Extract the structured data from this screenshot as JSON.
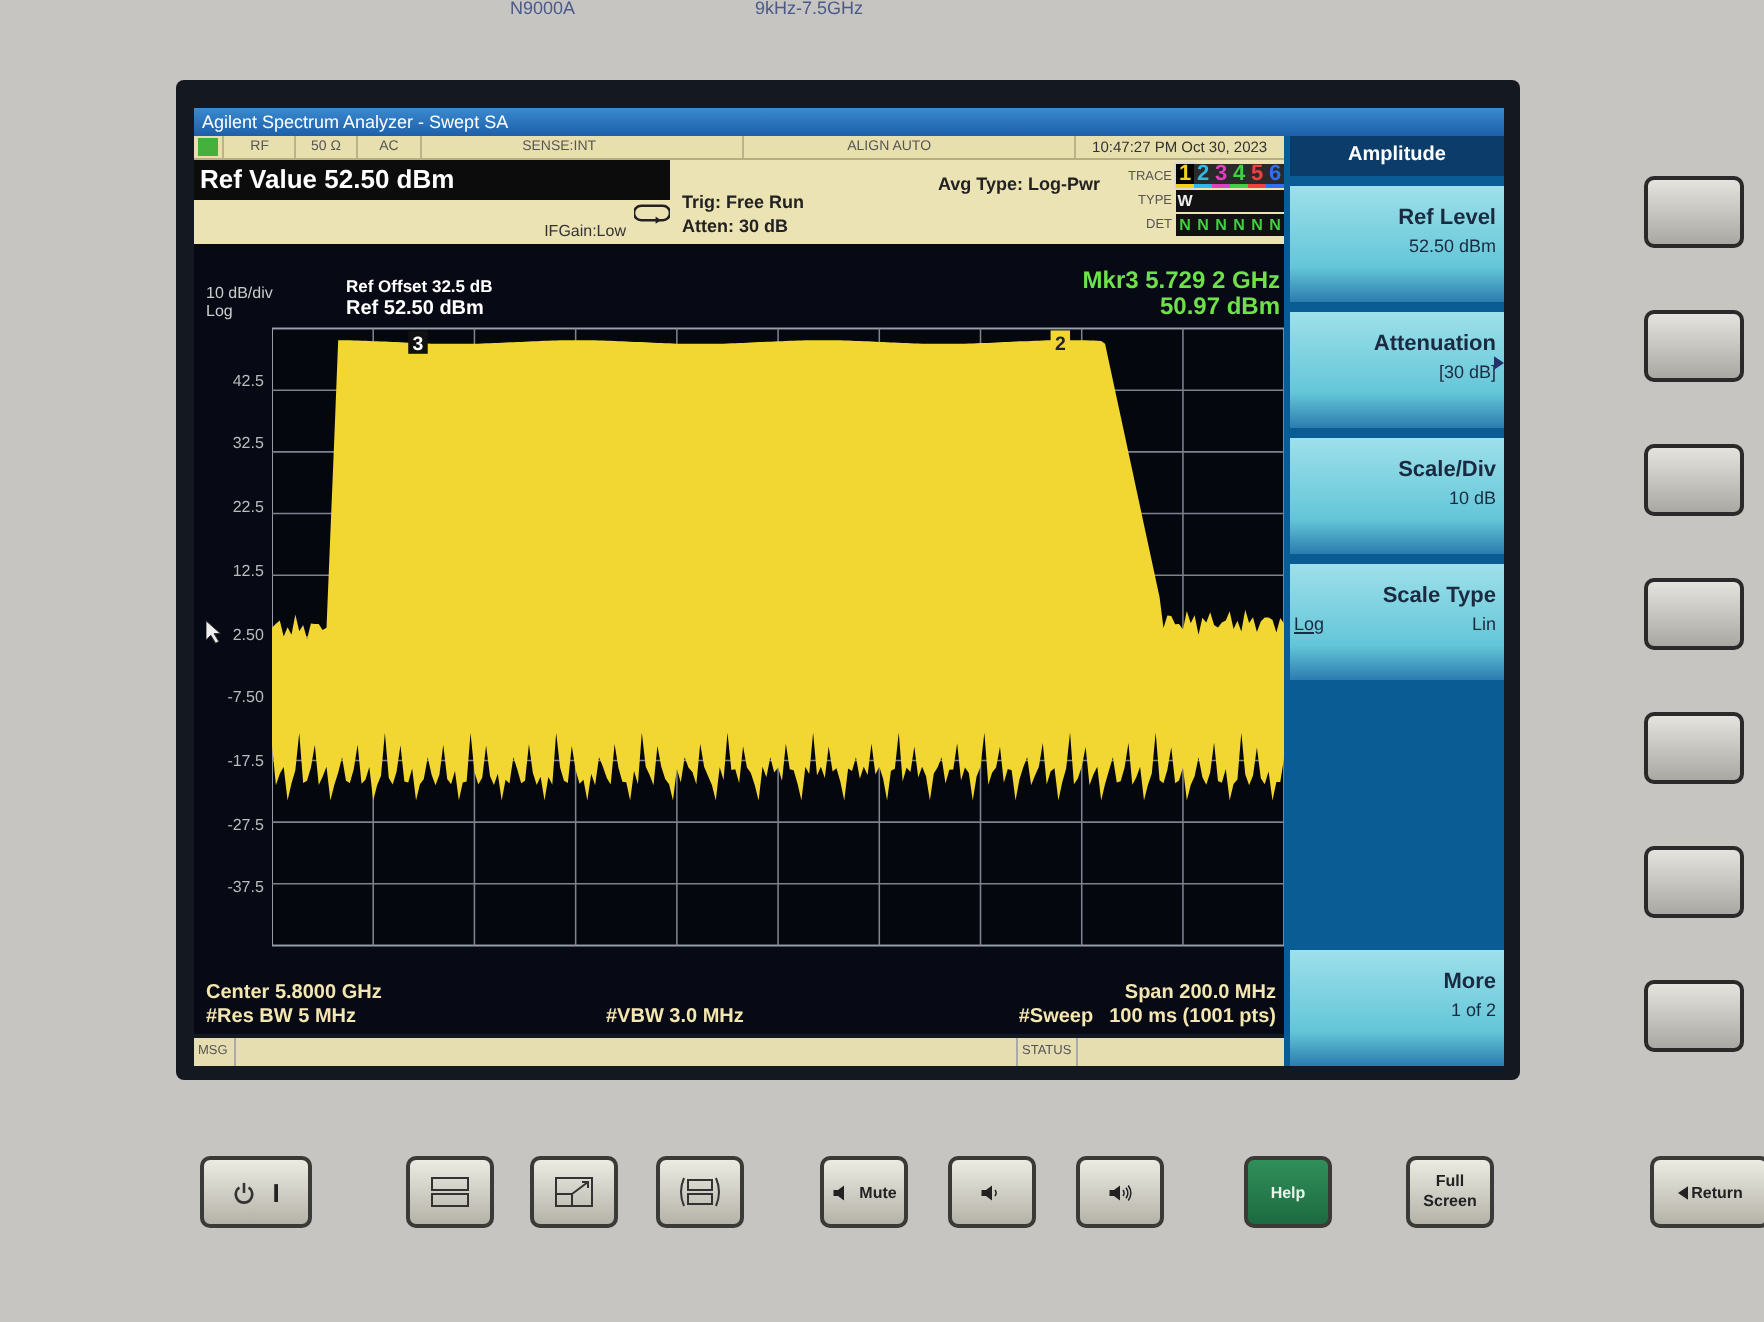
{
  "bezel": {
    "model": "N9000A",
    "range": "9kHz-7.5GHz"
  },
  "window": {
    "title": "Agilent Spectrum Analyzer - Swept SA"
  },
  "status_row": [
    "RF",
    "50 Ω",
    "AC",
    "SENSE:INT",
    "ALIGN AUTO",
    "10:47:27 PM Oct 30, 2023"
  ],
  "active_function": "Ref Value 52.50 dBm",
  "if_gain": "IFGain:Low",
  "trigger": "Trig: Free Run",
  "atten": "Atten: 30 dB",
  "avg_type": "Avg Type: Log-Pwr",
  "trace_table": {
    "trace_label": "TRACE",
    "type_label": "TYPE",
    "det_label": "DET",
    "traces": [
      {
        "label": "1",
        "color": "#f0d020",
        "selected": true,
        "type": "W",
        "det": "N"
      },
      {
        "label": "2",
        "color": "#30b8e8",
        "selected": false,
        "det": "N"
      },
      {
        "label": "3",
        "color": "#e040c0",
        "selected": false,
        "det": "N"
      },
      {
        "label": "4",
        "color": "#40d040",
        "selected": false,
        "det": "N"
      },
      {
        "label": "5",
        "color": "#f04040",
        "selected": false,
        "det": "N"
      },
      {
        "label": "6",
        "color": "#3070f0",
        "selected": false,
        "det": "N"
      }
    ]
  },
  "graph": {
    "ref_offset": "Ref Offset 32.5 dB",
    "ref": "Ref 52.50 dBm",
    "scale": "10 dB/div",
    "scale_type": "Log",
    "marker_freq": "Mkr3 5.729 2 GHz",
    "marker_value": "50.97 dBm",
    "y_ticks": [
      "42.5",
      "32.5",
      "22.5",
      "12.5",
      "2.50",
      "-7.50",
      "-17.5",
      "-27.5",
      "-37.5"
    ],
    "markers": [
      {
        "label": "3",
        "active": true
      },
      {
        "label": "2",
        "active": false
      }
    ],
    "center": "Center 5.8000 GHz",
    "res_bw": "#Res BW 5 MHz",
    "vbw": "#VBW 3.0 MHz",
    "span": "Span 200.0 MHz",
    "sweep_label": "#Sweep",
    "sweep": "100 ms (1001 pts)"
  },
  "msg_bar": {
    "msg": "MSG",
    "status": "STATUS"
  },
  "menu": {
    "title": "Amplitude",
    "keys": [
      {
        "kind": "value",
        "label": "Ref Level",
        "value": "52.50 dBm"
      },
      {
        "kind": "submenu",
        "label": "Attenuation",
        "value": "[30 dB]"
      },
      {
        "kind": "value",
        "label": "Scale/Div",
        "value": "10 dB"
      },
      {
        "kind": "toggle",
        "label": "Scale Type",
        "options": [
          {
            "label": "Log",
            "selected": true
          },
          {
            "label": "Lin",
            "selected": false
          }
        ]
      },
      {
        "kind": "spacer"
      },
      {
        "kind": "value",
        "label": "More",
        "value": "1 of 2"
      }
    ]
  },
  "front_buttons": [
    {
      "kind": "power",
      "label": "I"
    },
    {
      "kind": "split"
    },
    {
      "kind": "zoom"
    },
    {
      "kind": "fit"
    },
    {
      "kind": "mute",
      "label": "Mute"
    },
    {
      "kind": "vol-down"
    },
    {
      "kind": "vol-up"
    },
    {
      "kind": "help",
      "label": "Help"
    },
    {
      "kind": "text",
      "label": "Full Screen"
    },
    {
      "kind": "return",
      "label": "Return"
    }
  ]
}
